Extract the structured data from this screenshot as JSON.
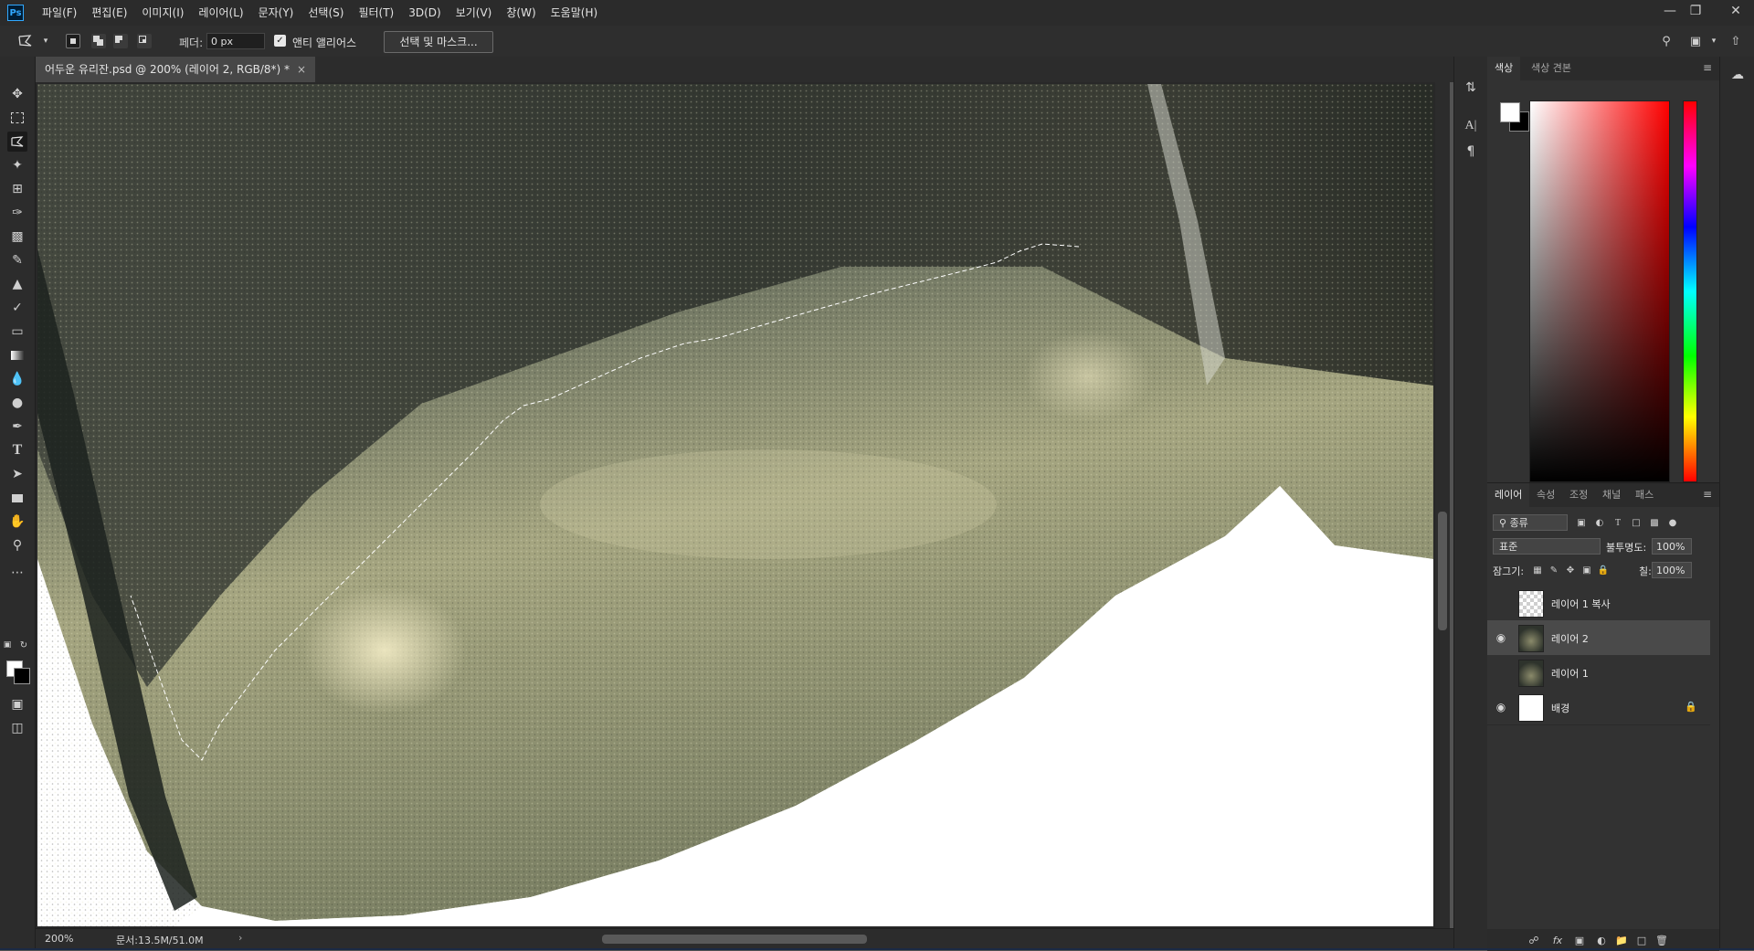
{
  "app": {
    "logo": "Ps"
  },
  "menu": [
    "파일(F)",
    "편집(E)",
    "이미지(I)",
    "레이어(L)",
    "문자(Y)",
    "선택(S)",
    "필터(T)",
    "3D(D)",
    "보기(V)",
    "창(W)",
    "도움말(H)"
  ],
  "options": {
    "feather_label": "페더:",
    "feather_value": "0 px",
    "antialias_label": "앤티 앨리어스",
    "antialias_checked": true,
    "select_mask_label": "선택 및 마스크..."
  },
  "document": {
    "tab_title": "어두운 유리잔.psd @ 200% (레이어 2, RGB/8*) *",
    "zoom": "200%",
    "doc_size": "문서:13.5M/51.0M"
  },
  "color_panel": {
    "tabs": [
      "색상",
      "색상 견본"
    ],
    "foreground": "#ffffff",
    "background": "#000000"
  },
  "layers_panel": {
    "tabs": [
      "레이어",
      "속성",
      "조정",
      "채널",
      "패스"
    ],
    "filter_label": "종류",
    "blend_mode": "표준",
    "opacity_label": "불투명도:",
    "opacity_value": "100%",
    "lock_label": "잠그기:",
    "fill_label": "칠:",
    "fill_value": "100%",
    "layers": [
      {
        "name": "레이어 1 복사",
        "visible": false,
        "selected": false
      },
      {
        "name": "레이어 2",
        "visible": true,
        "selected": true
      },
      {
        "name": "레이어 1",
        "visible": false,
        "selected": false
      },
      {
        "name": "배경",
        "visible": true,
        "selected": false,
        "locked": true
      }
    ]
  },
  "colors": {
    "ui_dark": "#2b2b2b",
    "ui_panel": "#323232",
    "accent": "#31a8ff"
  }
}
